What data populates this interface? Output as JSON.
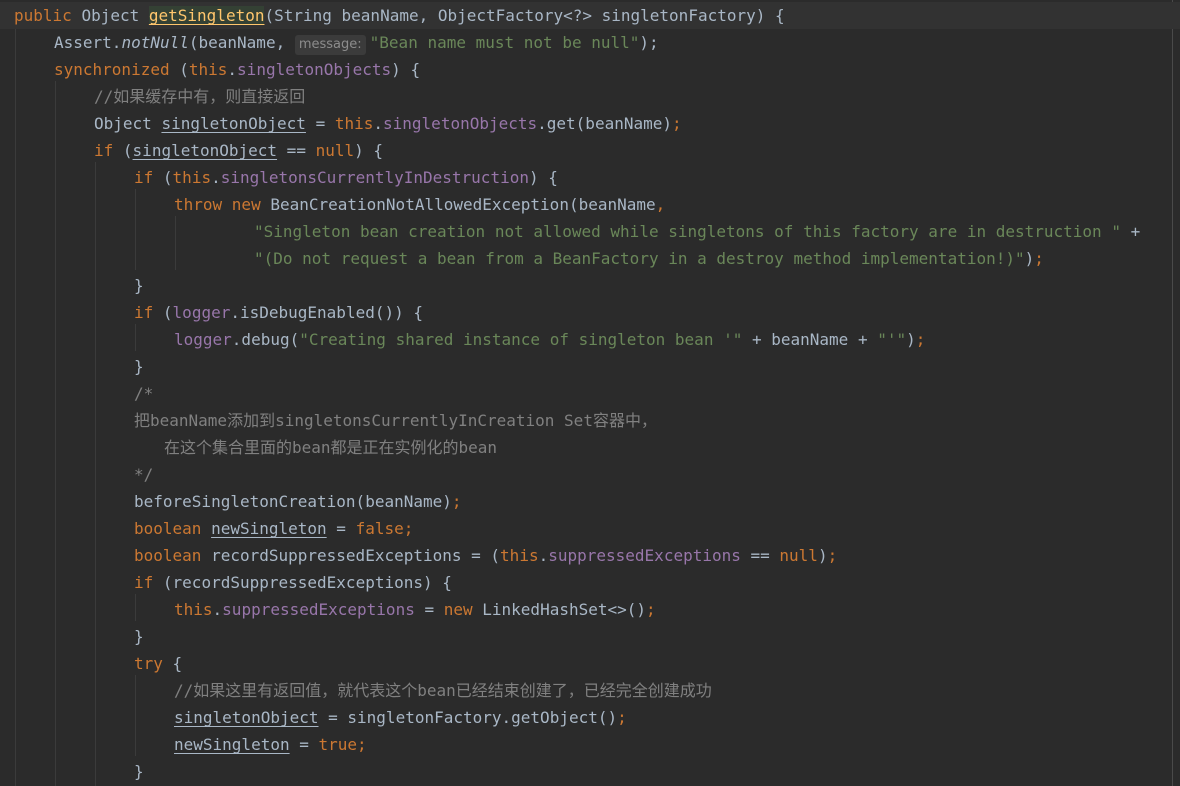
{
  "code": {
    "l1": {
      "a": "public ",
      "b": "Object ",
      "c": "getSingleton",
      "d": "(String beanName, ObjectFactory<?> singletonFactory) {"
    },
    "l2": {
      "a": "Assert.",
      "b": "notNull",
      "c": "(beanName, ",
      "hint": "message:",
      "d": "\"Bean name must not be null\"",
      "e": ");"
    },
    "l3": {
      "a": "synchronized ",
      "b": "(",
      "c": "this",
      "d": ".",
      "e": "singletonObjects",
      "f": ") {"
    },
    "l4": {
      "a": "//如果缓存中有，则直接返回"
    },
    "l5": {
      "a": "Object ",
      "b": "singletonObject",
      "c": " = ",
      "d": "this",
      "e": ".",
      "f": "singletonObjects",
      "g": ".get(beanName)",
      "h": ";"
    },
    "l6": {
      "a": "if ",
      "b": "(",
      "c": "singletonObject",
      "d": " == ",
      "e": "null",
      "f": ") {"
    },
    "l7": {
      "a": "if ",
      "b": "(",
      "c": "this",
      "d": ".",
      "e": "singletonsCurrentlyInDestruction",
      "f": ") {"
    },
    "l8": {
      "a": "throw ",
      "b": "new ",
      "c": "BeanCreationNotAllowedException(beanName",
      "d": ","
    },
    "l9": {
      "a": "\"Singleton bean creation not allowed while singletons of this factory are in destruction \"",
      "b": " +"
    },
    "l10": {
      "a": "\"(Do not request a bean from a BeanFactory in a destroy method implementation!)\"",
      "b": ")",
      "c": ";"
    },
    "l11": {
      "a": "}"
    },
    "l12": {
      "a": "if ",
      "b": "(",
      "c": "logger",
      "d": ".isDebugEnabled()) {"
    },
    "l13": {
      "a": "logger",
      "b": ".debug(",
      "c": "\"Creating shared instance of singleton bean '\"",
      "d": " + beanName + ",
      "e": "\"'\"",
      "f": ")",
      "g": ";"
    },
    "l14": {
      "a": "}"
    },
    "l15": {
      "a": "/*"
    },
    "l16": {
      "a": "把beanName添加到singletonsCurrentlyInCreation Set容器中，"
    },
    "l17": {
      "a": "在这个集合里面的bean都是正在实例化的bean"
    },
    "l18": {
      "a": "*/"
    },
    "l19": {
      "a": "beforeSingletonCreation(beanName)",
      "b": ";"
    },
    "l20": {
      "a": "boolean ",
      "b": "newSingleton",
      "c": " = ",
      "d": "false",
      "e": ";"
    },
    "l21": {
      "a": "boolean ",
      "b": "recordSuppressedExceptions = (",
      "c": "this",
      "d": ".",
      "e": "suppressedExceptions",
      "f": " == ",
      "g": "null",
      "h": ")",
      "i": ";"
    },
    "l22": {
      "a": "if ",
      "b": "(recordSuppressedExceptions) {"
    },
    "l23": {
      "a": "this",
      "b": ".",
      "c": "suppressedExceptions",
      "d": " = ",
      "e": "new ",
      "f": "LinkedHashSet<>()",
      "g": ";"
    },
    "l24": {
      "a": "}"
    },
    "l25": {
      "a": "try ",
      "b": "{"
    },
    "l26": {
      "a": "//如果这里有返回值，就代表这个bean已经结束创建了，已经完全创建成功"
    },
    "l27": {
      "a": "singletonObject",
      "b": " = singletonFactory.getObject()",
      "c": ";"
    },
    "l28": {
      "a": "newSingleton",
      "b": " = ",
      "c": "true",
      "d": ";"
    },
    "l29": {
      "a": "}"
    }
  }
}
